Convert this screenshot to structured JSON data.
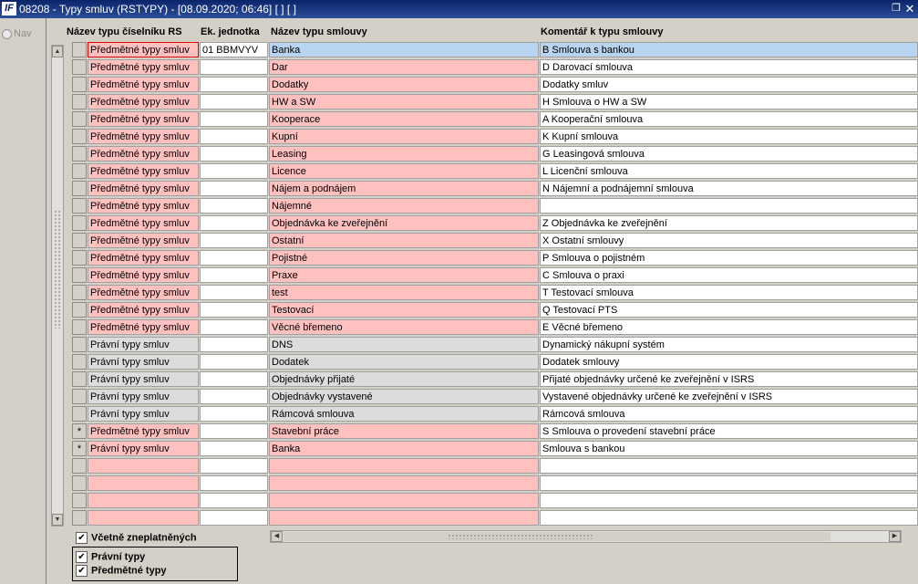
{
  "window": {
    "logo": "IF",
    "title": "08208 - Typy smluv (RSTYPY) - [08.09.2020; 06:46]  [ ]  [ ]",
    "restore_glyph": "❐",
    "close_glyph": "✕"
  },
  "nav": {
    "label": "Nav"
  },
  "columns": {
    "type": "Název typu číselníku RS",
    "unit": "Ek. jednotka",
    "name": "Název typu smlouvy",
    "comment": "Komentář k typu smlouvy"
  },
  "rows": [
    {
      "sel": "",
      "type": "Předmětné typy smluv",
      "unit": "01 BBMVYV",
      "name": "Banka",
      "comment": "B Smlouva s bankou",
      "kind": "selected"
    },
    {
      "sel": "",
      "type": "Předmětné typy smluv",
      "unit": "",
      "name": "Dar",
      "comment": "D Darovací smlouva",
      "kind": "pink"
    },
    {
      "sel": "",
      "type": "Předmětné typy smluv",
      "unit": "",
      "name": "Dodatky",
      "comment": "Dodatky smluv",
      "kind": "pink"
    },
    {
      "sel": "",
      "type": "Předmětné typy smluv",
      "unit": "",
      "name": "HW a SW",
      "comment": "H Smlouva o HW a SW",
      "kind": "pink"
    },
    {
      "sel": "",
      "type": "Předmětné typy smluv",
      "unit": "",
      "name": "Kooperace",
      "comment": "A Kooperační smlouva",
      "kind": "pink"
    },
    {
      "sel": "",
      "type": "Předmětné typy smluv",
      "unit": "",
      "name": "Kupní",
      "comment": "K Kupní smlouva",
      "kind": "pink"
    },
    {
      "sel": "",
      "type": "Předmětné typy smluv",
      "unit": "",
      "name": "Leasing",
      "comment": "G Leasingová smlouva",
      "kind": "pink"
    },
    {
      "sel": "",
      "type": "Předmětné typy smluv",
      "unit": "",
      "name": "Licence",
      "comment": "L Licenční smlouva",
      "kind": "pink"
    },
    {
      "sel": "",
      "type": "Předmětné typy smluv",
      "unit": "",
      "name": "Nájem a podnájem",
      "comment": "N Nájemní a podnájemní smlouva",
      "kind": "pink"
    },
    {
      "sel": "",
      "type": "Předmětné typy smluv",
      "unit": "",
      "name": "Nájemné",
      "comment": "",
      "kind": "pink"
    },
    {
      "sel": "",
      "type": "Předmětné typy smluv",
      "unit": "",
      "name": "Objednávka ke zveřejnění",
      "comment": "Z Objednávka ke zveřejnění",
      "kind": "pink"
    },
    {
      "sel": "",
      "type": "Předmětné typy smluv",
      "unit": "",
      "name": "Ostatní",
      "comment": "X Ostatní smlouvy",
      "kind": "pink"
    },
    {
      "sel": "",
      "type": "Předmětné typy smluv",
      "unit": "",
      "name": "Pojistné",
      "comment": "P Smlouva o pojistném",
      "kind": "pink"
    },
    {
      "sel": "",
      "type": "Předmětné typy smluv",
      "unit": "",
      "name": "Praxe",
      "comment": "C Smlouva o praxi",
      "kind": "pink"
    },
    {
      "sel": "",
      "type": "Předmětné typy smluv",
      "unit": "",
      "name": "test",
      "comment": "T Testovací smlouva",
      "kind": "pink"
    },
    {
      "sel": "",
      "type": "Předmětné typy smluv",
      "unit": "",
      "name": "Testovací",
      "comment": "Q Testovací PTS",
      "kind": "pink"
    },
    {
      "sel": "",
      "type": "Předmětné typy smluv",
      "unit": "",
      "name": "Věcné břemeno",
      "comment": "E Věcné břemeno",
      "kind": "pink"
    },
    {
      "sel": "",
      "type": "Právní typy smluv",
      "unit": "",
      "name": "DNS",
      "comment": "Dynamický nákupní systém",
      "kind": "gray"
    },
    {
      "sel": "",
      "type": "Právní typy smluv",
      "unit": "",
      "name": "Dodatek",
      "comment": "Dodatek smlouvy",
      "kind": "gray"
    },
    {
      "sel": "",
      "type": "Právní typy smluv",
      "unit": "",
      "name": "Objednávky přijaté",
      "comment": "Přijaté objednávky určené ke zveřejnění v ISRS",
      "kind": "gray"
    },
    {
      "sel": "",
      "type": "Právní typy smluv",
      "unit": "",
      "name": "Objednávky vystavené",
      "comment": "Vystavené objednávky určené ke zveřejnění v ISRS",
      "kind": "gray"
    },
    {
      "sel": "",
      "type": "Právní typy smluv",
      "unit": "",
      "name": "Rámcová smlouva",
      "comment": "Rámcová smlouva",
      "kind": "gray"
    },
    {
      "sel": "*",
      "type": "Předmětné typy smluv",
      "unit": "",
      "name": "Stavební práce",
      "comment": "S Smlouva o provedení stavební práce",
      "kind": "pink"
    },
    {
      "sel": "*",
      "type": "Právní typy smluv",
      "unit": "",
      "name": "Banka",
      "comment": "Smlouva s bankou",
      "kind": "pink"
    },
    {
      "sel": "",
      "type": "",
      "unit": "",
      "name": "",
      "comment": "",
      "kind": "pink"
    },
    {
      "sel": "",
      "type": "",
      "unit": "",
      "name": "",
      "comment": "",
      "kind": "pink"
    },
    {
      "sel": "",
      "type": "",
      "unit": "",
      "name": "",
      "comment": "",
      "kind": "pink"
    },
    {
      "sel": "",
      "type": "",
      "unit": "",
      "name": "",
      "comment": "",
      "kind": "pink"
    }
  ],
  "scrollbars": {
    "up": "▲",
    "down": "▼",
    "left": "◀",
    "right": "▶"
  },
  "checkboxes": {
    "including_invalid": {
      "label": "Včetně zneplatněných",
      "checked": true
    },
    "legal_types": {
      "label": "Právní typy",
      "checked": true
    },
    "subject_types": {
      "label": "Předmětné typy",
      "checked": true
    },
    "check_glyph": "✔"
  },
  "colors": {
    "pink": "#ffc0c0",
    "selected": "#b8d4f0",
    "gray": "#dcdcdc",
    "titlebar": "#0a246a"
  }
}
